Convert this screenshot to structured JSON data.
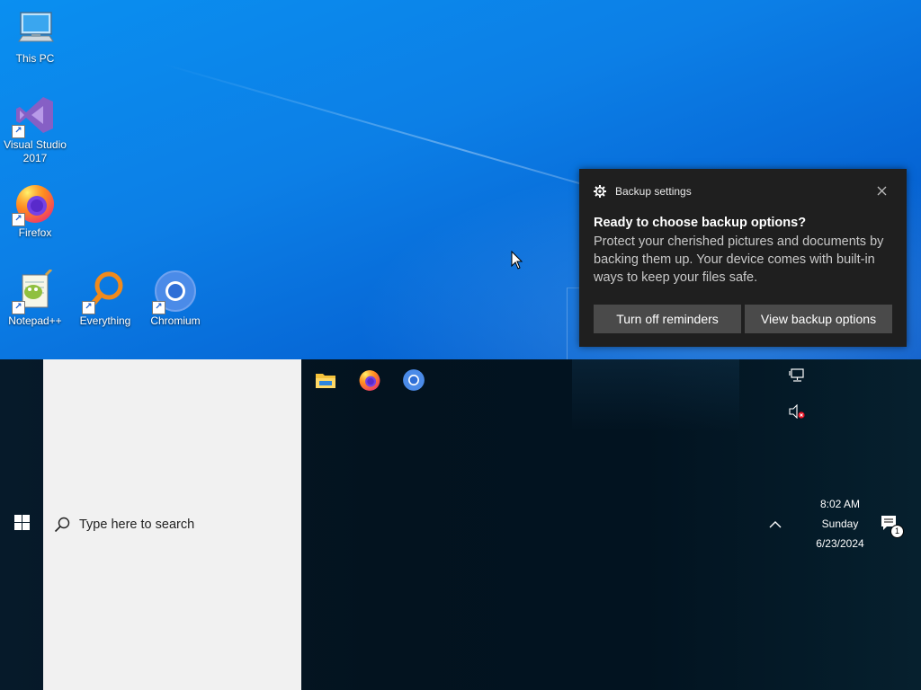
{
  "desktop": {
    "icons": [
      {
        "label": "This PC",
        "icon": "computer-icon"
      },
      {
        "label": "Visual Studio 2017",
        "icon": "visual-studio-icon"
      },
      {
        "label": "Firefox",
        "icon": "firefox-icon"
      },
      {
        "label": "Notepad++",
        "icon": "notepadpp-icon"
      },
      {
        "label": "Everything",
        "icon": "everything-search-icon"
      },
      {
        "label": "Chromium",
        "icon": "chromium-icon"
      }
    ]
  },
  "toast": {
    "app_name": "Backup settings",
    "title": "Ready to choose backup options?",
    "body": "Protect your cherished pictures and documents by backing them up. Your device comes with built-in ways to keep your files safe.",
    "button_dismiss": "Turn off reminders",
    "button_view": "View backup options"
  },
  "taskbar": {
    "search_placeholder": "Type here to search",
    "pinned_apps": [
      "file-explorer-icon",
      "firefox-icon",
      "chromium-icon"
    ],
    "clock": {
      "time": "8:02 AM",
      "day": "Sunday",
      "date": "6/23/2024"
    },
    "notification_count": "1",
    "tray_icons": [
      "network-icon",
      "volume-muted-icon",
      "chevron-up-icon"
    ]
  },
  "colors": {
    "desktop_blue": "#0a7ee8",
    "toast_bg": "#1f1f1f",
    "toast_button": "#4a4a4a",
    "taskbar_bg": "#03131f",
    "search_bg": "#f1f1f1"
  }
}
